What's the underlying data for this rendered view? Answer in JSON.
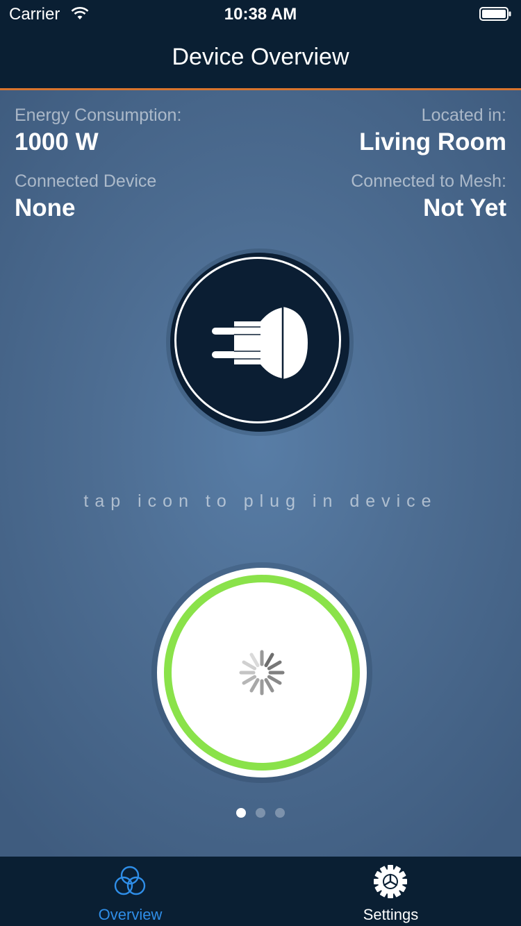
{
  "status_bar": {
    "carrier": "Carrier",
    "time": "10:38 AM"
  },
  "nav": {
    "title": "Device Overview"
  },
  "info": {
    "energy_label": "Energy Consumption:",
    "energy_value": "1000 W",
    "location_label": "Located in:",
    "location_value": "Living Room",
    "device_label": "Connected Device",
    "device_value": "None",
    "mesh_label": "Connected to Mesh:",
    "mesh_value": "Not Yet"
  },
  "hint": "tap icon to plug in device",
  "page_indicator": {
    "count": 3,
    "current": 1
  },
  "tabs": [
    {
      "label": "Overview",
      "icon": "overview-circles-icon",
      "selected": true
    },
    {
      "label": "Settings",
      "icon": "gear-icon",
      "selected": false
    }
  ],
  "colors": {
    "nav_background": "#0a1f33",
    "accent_orange": "#d9742e",
    "progress_green": "#8ae24a",
    "tab_selected": "#2f8ee8"
  }
}
